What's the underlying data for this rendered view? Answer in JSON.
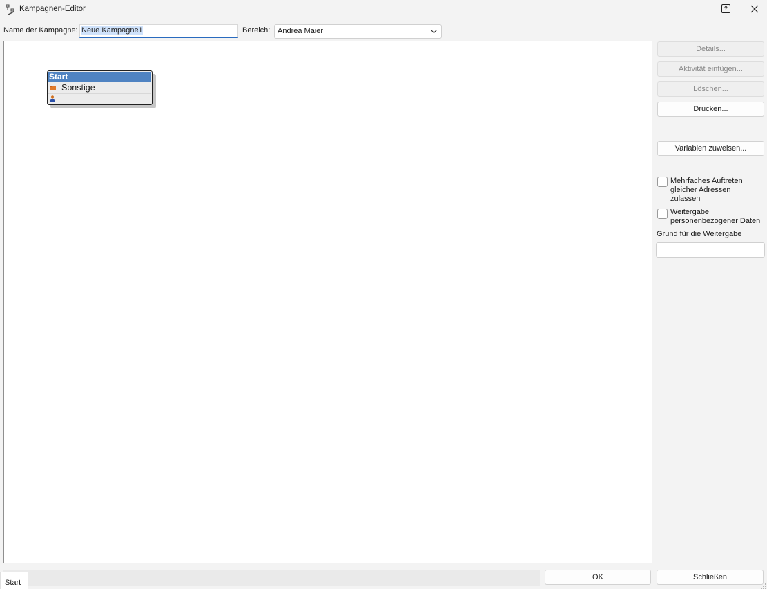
{
  "window": {
    "title": "Kampagnen-Editor"
  },
  "form": {
    "name_label": "Name der Kampagne:",
    "name_value": "Neue Kampagne1",
    "bereich_label": "Bereich:",
    "bereich_value": "Andrea Maier"
  },
  "canvas": {
    "start_node": {
      "title": "Start",
      "row1": "Sonstige"
    }
  },
  "sidebar": {
    "details": "Details...",
    "insert_activity": "Aktivität einfügen...",
    "delete": "Löschen...",
    "print": "Drucken...",
    "assign_variables": "Variablen zuweisen...",
    "multi_address_label": "Mehrfaches Auftreten gleicher Adressen zulassen",
    "multi_address_checked": false,
    "share_data_label": "Weitergabe personenbezogener Daten",
    "share_data_checked": false,
    "reason_label": "Grund für die Weitergabe",
    "reason_value": ""
  },
  "footer": {
    "tab_start": "Start",
    "ok": "OK",
    "close": "Schließen"
  },
  "colors": {
    "node_header": "#4f83c2",
    "input_focus": "#2a6bbf",
    "selection": "#cfe2fb"
  }
}
